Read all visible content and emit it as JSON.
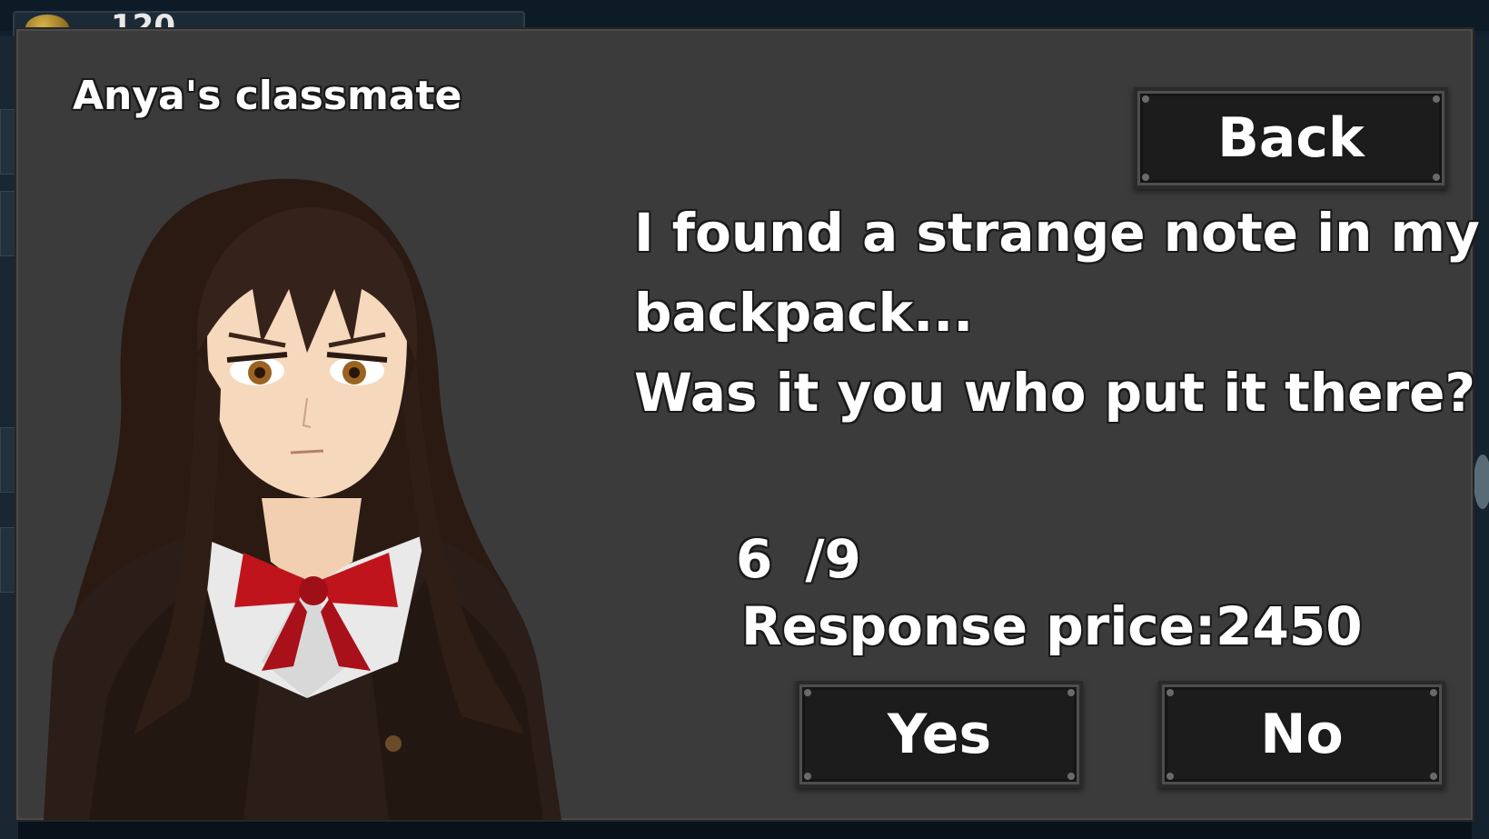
{
  "background": {
    "coin_counter_text": "120"
  },
  "dialog": {
    "speaker_name": "Anya's classmate",
    "message_lines": [
      "I found a strange note in my",
      "backpack...",
      "Was it you who put it there?"
    ],
    "counter": {
      "current": "6",
      "total": "/9"
    },
    "price": {
      "label": "Response price:",
      "value": "2450"
    },
    "buttons": {
      "back": "Back",
      "yes": "Yes",
      "no": "No"
    },
    "portrait_icon": "anime-schoolgirl-portrait",
    "colors": {
      "panel": "#3b3b3b",
      "button": "#1c1c1c",
      "text": "#ffffff",
      "ribbon": "#c0141c"
    }
  }
}
